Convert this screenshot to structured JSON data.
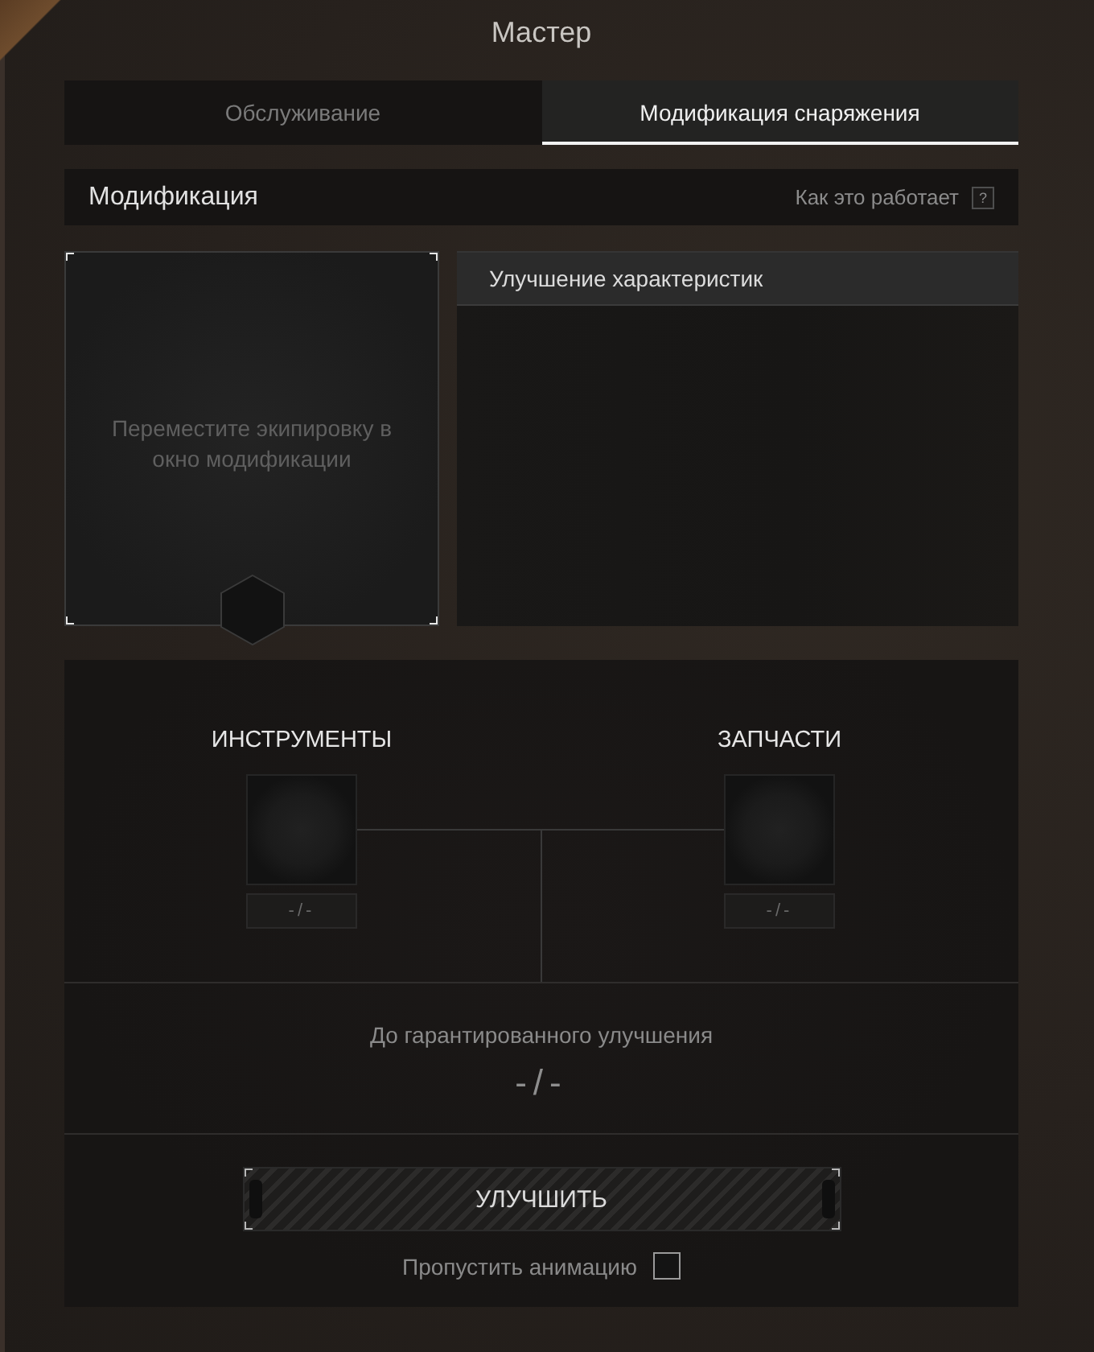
{
  "window": {
    "title": "Мастер"
  },
  "tabs": [
    {
      "label": "Обслуживание",
      "selected": false
    },
    {
      "label": "Модификация снаряжения",
      "selected": true
    }
  ],
  "section": {
    "title": "Модификация",
    "help_label": "Как это работает",
    "help_mark": "?"
  },
  "drop_slot": {
    "hint": "Переместите экипировку в окно модификации"
  },
  "stats_panel": {
    "title": "Улучшение характеристик"
  },
  "materials": [
    {
      "label": "ИНСТРУМЕНТЫ",
      "count": "-/-"
    },
    {
      "label": "ЗАПЧАСТИ",
      "count": "-/-"
    }
  ],
  "guarantee": {
    "label": "До гарантированного улучшения",
    "value": "-/-"
  },
  "upgrade_button": {
    "label": "УЛУЧШИТЬ"
  },
  "skip_animation": {
    "label": "Пропустить анимацию",
    "checked": false
  }
}
